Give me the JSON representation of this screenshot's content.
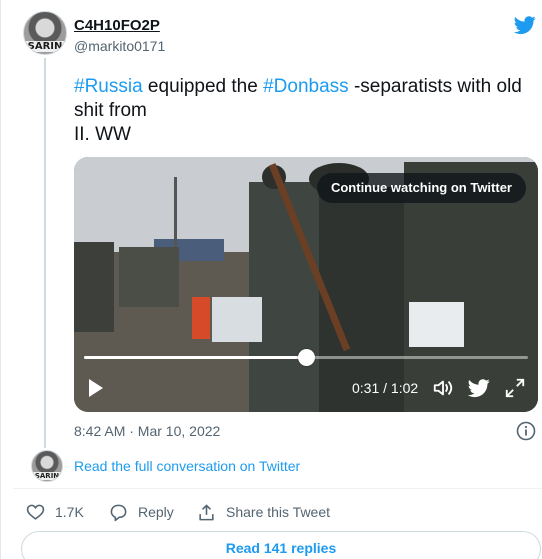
{
  "author": {
    "display_name": "C4H10FO2P",
    "handle": "@markito0171",
    "avatar_text": "SARIN"
  },
  "tweet": {
    "segments": [
      {
        "text": "#Russia",
        "type": "hashtag"
      },
      {
        "text": " equipped the ",
        "type": "text"
      },
      {
        "text": "#Donbass",
        "type": "hashtag"
      },
      {
        "text": " -separatists with old shit from",
        "type": "text"
      }
    ],
    "line2": "II. WW"
  },
  "video": {
    "continue_label": "Continue watching on Twitter",
    "time_label": "0:31 / 1:02",
    "progress": 0.5
  },
  "meta": {
    "timestamp": "8:42 AM · Mar 10, 2022"
  },
  "conversation": {
    "link_label": "Read the full conversation on Twitter"
  },
  "actions": {
    "likes": "1.7K",
    "reply_label": "Reply",
    "share_label": "Share this Tweet"
  },
  "replies_button": "Read 141 replies",
  "icons": [
    "twitter-logo-icon",
    "play-icon",
    "volume-icon",
    "twitter-small-icon",
    "fullscreen-icon",
    "info-icon",
    "heart-icon",
    "reply-icon",
    "share-icon"
  ],
  "colors": {
    "accent": "#1d9bf0",
    "muted": "#536471",
    "text": "#0f1419"
  }
}
